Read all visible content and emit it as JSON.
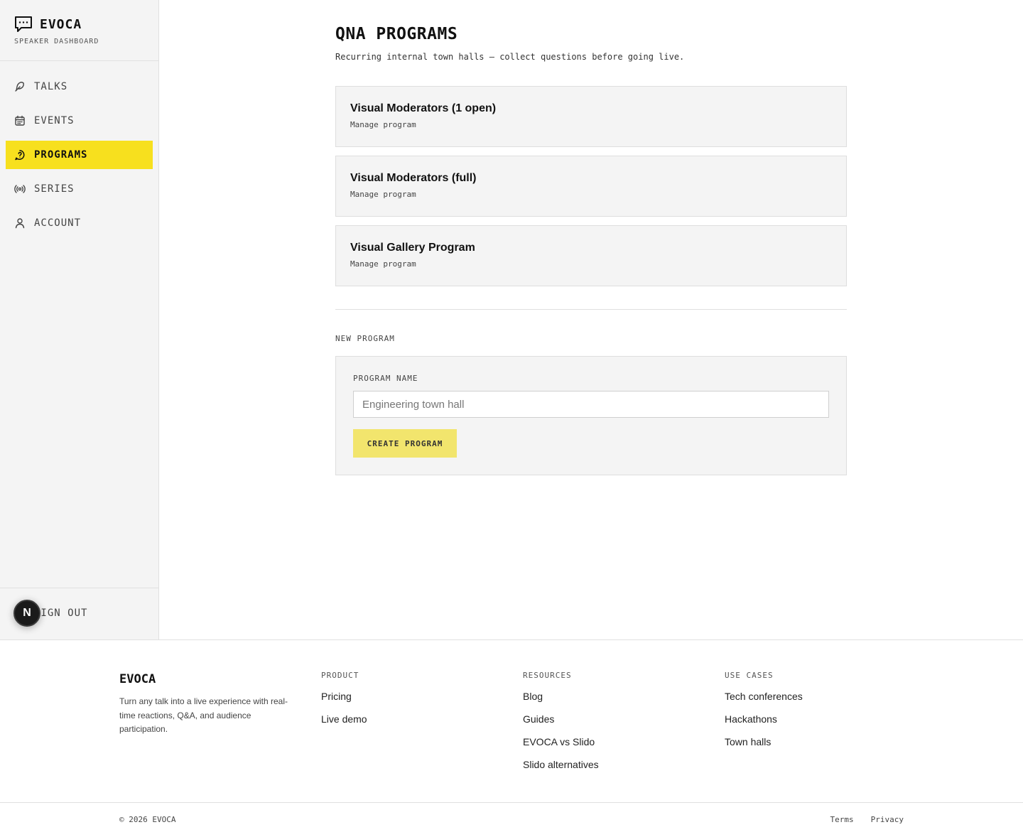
{
  "sidebar": {
    "brand": "EVOCA",
    "subtitle": "SPEAKER DASHBOARD",
    "items": [
      {
        "label": "TALKS",
        "icon": "feather-icon",
        "active": false
      },
      {
        "label": "EVENTS",
        "icon": "calendar-icon",
        "active": false
      },
      {
        "label": "PROGRAMS",
        "icon": "help-circle-icon",
        "active": true
      },
      {
        "label": "SERIES",
        "icon": "radio-icon",
        "active": false
      },
      {
        "label": "ACCOUNT",
        "icon": "user-icon",
        "active": false
      }
    ],
    "signout": "SIGN OUT",
    "badge": "N"
  },
  "main": {
    "title": "QNA PROGRAMS",
    "subtitle": "Recurring internal town halls — collect questions before going live.",
    "programs": [
      {
        "name": "Visual Moderators (1 open)",
        "action": "Manage program"
      },
      {
        "name": "Visual Moderators (full)",
        "action": "Manage program"
      },
      {
        "name": "Visual Gallery Program",
        "action": "Manage program"
      }
    ],
    "new_section": "NEW PROGRAM",
    "form": {
      "label": "PROGRAM NAME",
      "placeholder": "Engineering town hall",
      "button": "CREATE PROGRAM"
    }
  },
  "footer": {
    "brand": "EVOCA",
    "description": "Turn any talk into a live experience with real-time reactions, Q&A, and audience participation.",
    "columns": [
      {
        "heading": "PRODUCT",
        "links": [
          "Pricing",
          "Live demo"
        ]
      },
      {
        "heading": "RESOURCES",
        "links": [
          "Blog",
          "Guides",
          "EVOCA vs Slido",
          "Slido alternatives"
        ]
      },
      {
        "heading": "USE CASES",
        "links": [
          "Tech conferences",
          "Hackathons",
          "Town halls"
        ]
      }
    ],
    "copyright": "© 2026 EVOCA",
    "legal": [
      "Terms",
      "Privacy"
    ]
  },
  "colors": {
    "accent": "#f7e01e",
    "button": "#f2e56d",
    "panel": "#f4f4f4"
  }
}
